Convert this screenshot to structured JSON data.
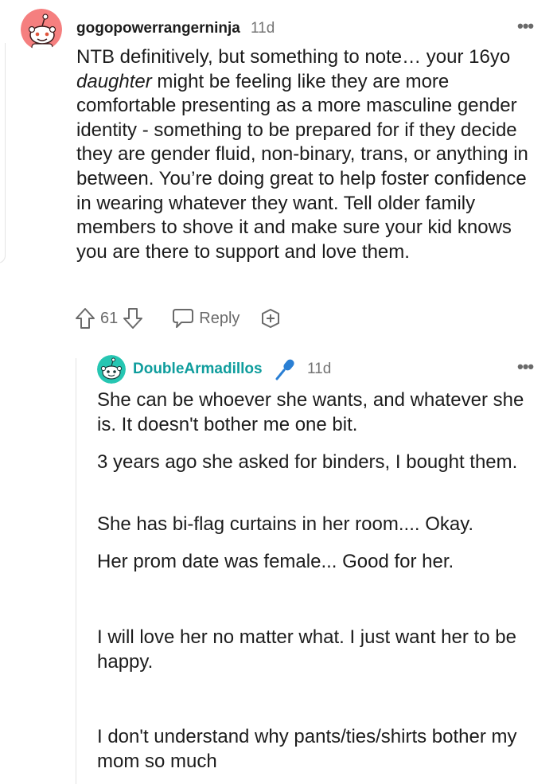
{
  "parent_comment": {
    "username": "gogopowerrangerninja",
    "time": "11d",
    "body_before_em": "NTB definitively, but something to note… your 16yo ",
    "body_em": "daughter",
    "body_after_em": " might be feeling like they are more comfortable presenting as a more masculine gender identity - something to be prepared for if they decide they are gender fluid, non-binary, trans, or anything in between. You’re doing great to help foster confidence in wearing whatever they want. Tell older family members to shove it and make sure your kid knows you are there to support and love them.",
    "vote_count": "61",
    "reply_label": "Reply",
    "avatar_color": "#f57f7f"
  },
  "reply_comment": {
    "username": "DoubleArmadillos",
    "username_color": "#0f9d9d",
    "time": "11d",
    "avatar_color": "#26c6b2",
    "paragraphs": [
      "She can be whoever she wants, and whatever she is. It doesn't bother me one bit.",
      "3 years ago she asked for binders, I bought them.",
      "She has bi-flag curtains in her room.... Okay.",
      "Her prom date was female... Good for her.",
      "I will love her no matter what. I just want her to be happy.",
      "I don't understand why pants/ties/shirts bother my mom so much"
    ]
  },
  "colors": {
    "text": "#1c1c1c",
    "meta": "#757575",
    "icon": "#6a6a6a",
    "mic_icon": "#2a7fd4"
  }
}
